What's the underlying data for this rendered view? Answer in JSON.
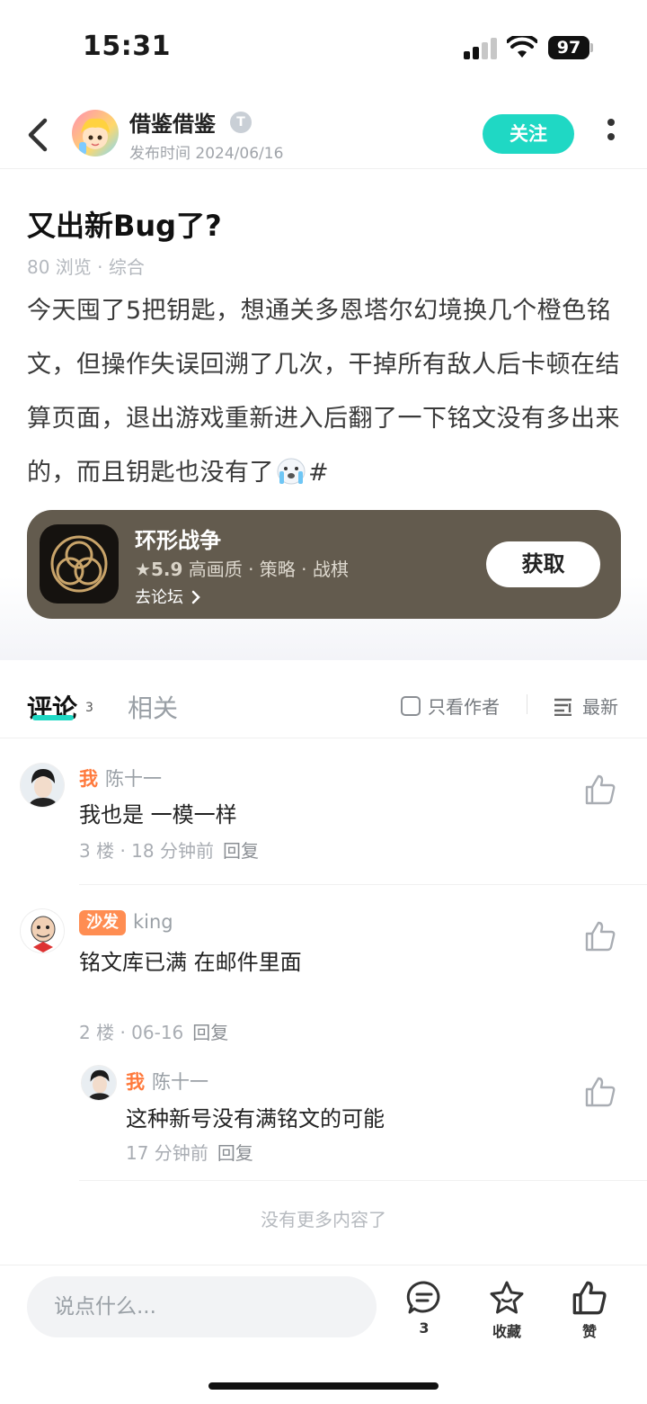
{
  "status_bar": {
    "time": "15:31",
    "battery": "97"
  },
  "header": {
    "author_name": "借鉴借鉴",
    "verify_badge": "T",
    "publish_time": "发布时间 2024/06/16",
    "follow_label": "关注"
  },
  "post": {
    "title": "又出新Bug了?",
    "meta": "80 浏览 · 综合",
    "body_part1": "今天囤了5把钥匙，想通关多恩塔尔幻境换几个橙色铭文，但操作失误回溯了几次，干掉所有敌人后卡顿在结算页面，退出游戏重新进入后翻了一下铭文没有多出来的，而且钥匙也没有了",
    "body_part2": "#"
  },
  "game_card": {
    "name": "环形战争",
    "rating": "5.9",
    "tags": "高画质 · 策略 · 战棋",
    "forum_link": "去论坛",
    "get_label": "获取",
    "bg_color": "#635b4e"
  },
  "tabs": {
    "comments_label": "评论",
    "comments_count": "3",
    "related_label": "相关",
    "only_author_label": "只看作者",
    "sort_label": "最新",
    "accent_color": "#1fd8c4"
  },
  "comments": [
    {
      "tag": "我",
      "username": "陈十一",
      "text": "我也是 一模一样",
      "meta": "3 楼 · 18 分钟前",
      "reply": "回复"
    },
    {
      "tag": "沙发",
      "username": "king",
      "text": "铭文库已满 在邮件里面",
      "meta": "2 楼 · 06-16",
      "reply": "回复",
      "replies": [
        {
          "tag": "我",
          "username": "陈十一",
          "text": "这种新号没有满铭文的可能",
          "meta": "17 分钟前",
          "reply": "回复"
        }
      ]
    }
  ],
  "no_more": "没有更多内容了",
  "bottom_bar": {
    "input_placeholder": "说点什么...",
    "comment_count": "3",
    "favorite_label": "收藏",
    "like_label": "赞"
  }
}
